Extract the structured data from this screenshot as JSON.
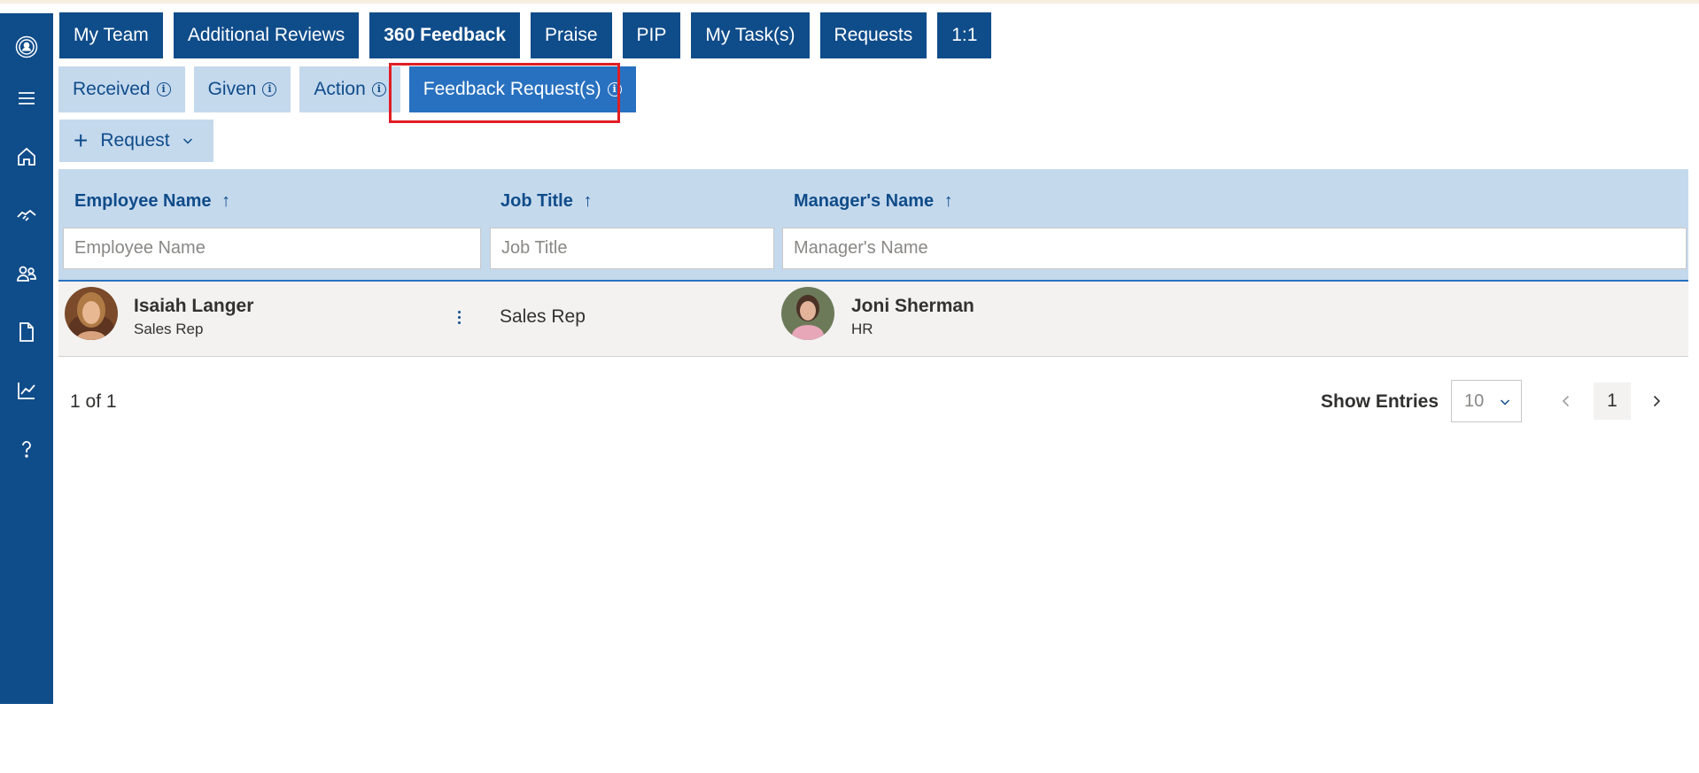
{
  "main_tabs": [
    {
      "label": "My Team"
    },
    {
      "label": "Additional Reviews"
    },
    {
      "label": "360 Feedback",
      "active": true
    },
    {
      "label": "Praise"
    },
    {
      "label": "PIP"
    },
    {
      "label": "My Task(s)"
    },
    {
      "label": "Requests"
    },
    {
      "label": "1:1"
    }
  ],
  "sub_tabs": [
    {
      "label": "Received",
      "icon": "info-icon"
    },
    {
      "label": "Given",
      "icon": "info-icon"
    },
    {
      "label": "Action",
      "icon": "info-icon"
    },
    {
      "label": "Feedback Request(s)",
      "icon": "info-icon",
      "active": true
    }
  ],
  "sidebar": {
    "icons": [
      "user-circle-icon",
      "menu-icon",
      "home-icon",
      "handshake-icon",
      "people-icon",
      "document-icon",
      "chart-icon",
      "help-icon"
    ]
  },
  "request_button": {
    "label": "Request",
    "icon": "plus-icon"
  },
  "table": {
    "columns": [
      {
        "label": "Employee Name",
        "sort": "↑"
      },
      {
        "label": "Job Title",
        "sort": "↑"
      },
      {
        "label": "Manager's Name",
        "sort": "↑"
      }
    ],
    "filters": {
      "employee_placeholder": "Employee Name",
      "job_placeholder": "Job Title",
      "manager_placeholder": "Manager's Name"
    },
    "rows": [
      {
        "employee_name": "Isaiah Langer",
        "employee_title": "Sales Rep",
        "job_title": "Sales Rep",
        "manager_name": "Joni Sherman",
        "manager_title": "HR"
      }
    ]
  },
  "footer": {
    "page_count": "1 of 1",
    "show_entries_label": "Show Entries",
    "entries_value": "10",
    "current_page": "1"
  },
  "colors": {
    "brand": "#0f4c8a",
    "accent": "#2871c0",
    "light": "#c5d9ed",
    "highlight": "#e01e24"
  }
}
